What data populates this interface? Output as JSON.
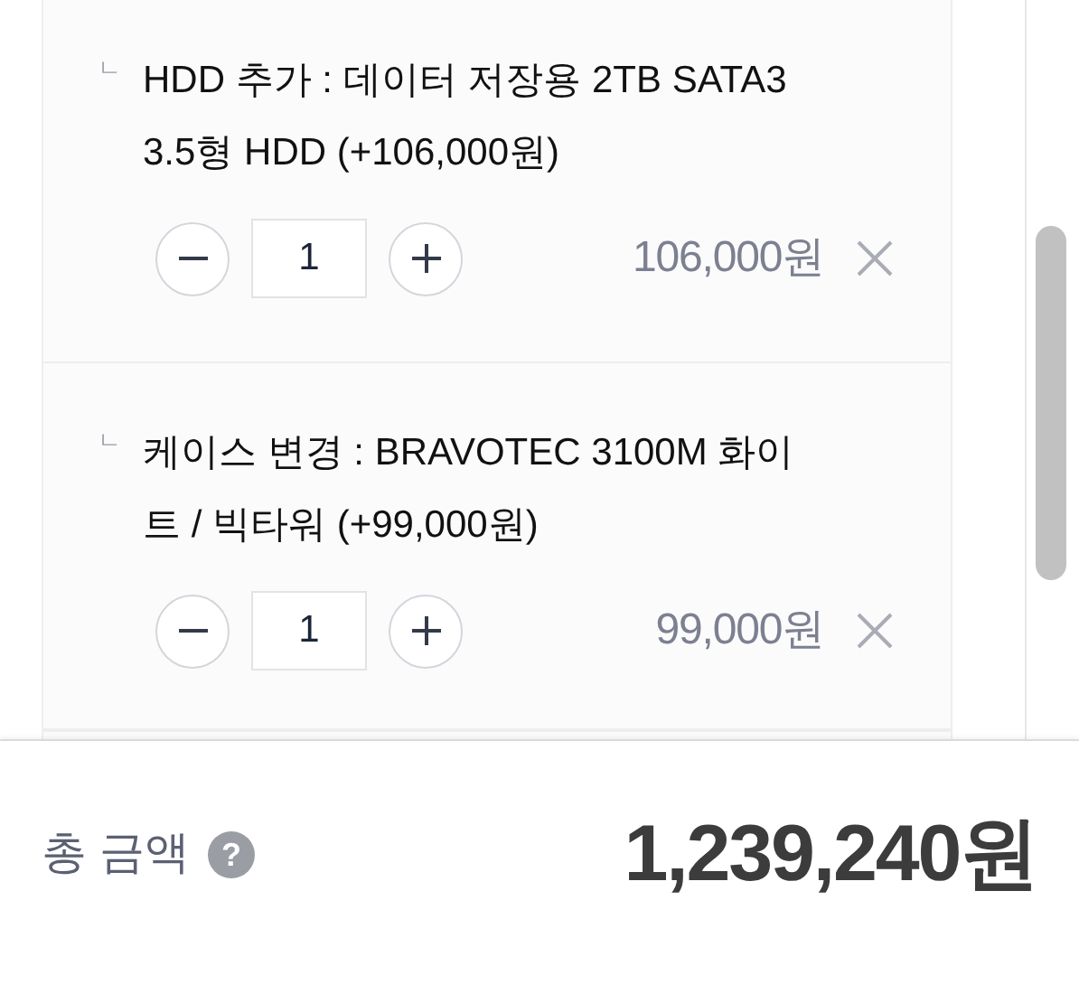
{
  "options": [
    {
      "marker": "ㄴ",
      "label": "HDD 추가 : 데이터 저장용 2TB SATA3 3.5형 HDD (+106,000원)",
      "quantity": "1",
      "price": "106,000원"
    },
    {
      "marker": "ㄴ",
      "label": "케이스 변경 : BRAVOTEC 3100M 화이트 / 빅타워 (+99,000원)",
      "quantity": "1",
      "price": "99,000원"
    }
  ],
  "total": {
    "label": "총 금액",
    "help": "?",
    "amount": "1,239,240원"
  }
}
